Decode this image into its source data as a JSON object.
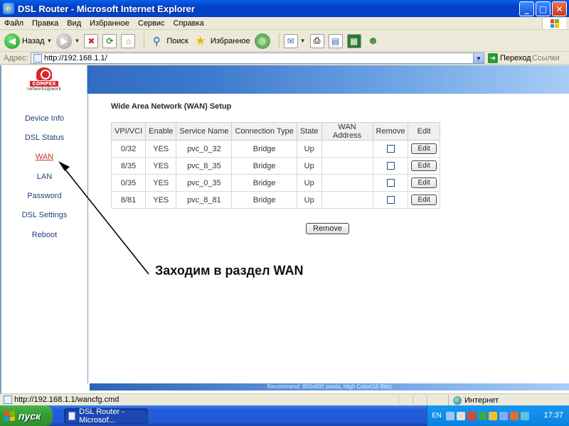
{
  "window": {
    "title": "DSL Router - Microsoft Internet Explorer",
    "controls": {
      "minimize": "_",
      "maximize": "□",
      "close": "✕"
    }
  },
  "menu": [
    "Файл",
    "Правка",
    "Вид",
    "Избранное",
    "Сервис",
    "Справка"
  ],
  "toolbar": {
    "back": "Назад",
    "search": "Поиск",
    "favorites": "Избранное"
  },
  "address": {
    "label": "Адрес:",
    "url": "http://192.168.1.1/",
    "go": "Переход",
    "links": "Ссылки"
  },
  "logo": {
    "name": "COMPEX",
    "sub": "networks@work"
  },
  "nav": {
    "items": [
      {
        "label": "Device Info"
      },
      {
        "label": "DSL Status"
      },
      {
        "label": "WAN"
      },
      {
        "label": "LAN"
      },
      {
        "label": "Password"
      },
      {
        "label": "DSL Settings"
      },
      {
        "label": "Reboot"
      }
    ],
    "active": "WAN"
  },
  "main": {
    "heading": "Wide Area Network (WAN) Setup",
    "columns": [
      "VPI/VCI",
      "Enable",
      "Service Name",
      "Connection Type",
      "State",
      "WAN Address",
      "Remove",
      "Edit"
    ],
    "rows": [
      {
        "vpivci": "0/32",
        "enable": "YES",
        "service": "pvc_0_32",
        "type": "Bridge",
        "state": "Up",
        "wan": "",
        "edit": "Edit"
      },
      {
        "vpivci": "8/35",
        "enable": "YES",
        "service": "pvc_8_35",
        "type": "Bridge",
        "state": "Up",
        "wan": "",
        "edit": "Edit"
      },
      {
        "vpivci": "0/35",
        "enable": "YES",
        "service": "pvc_0_35",
        "type": "Bridge",
        "state": "Up",
        "wan": "",
        "edit": "Edit"
      },
      {
        "vpivci": "8/81",
        "enable": "YES",
        "service": "pvc_8_81",
        "type": "Bridge",
        "state": "Up",
        "wan": "",
        "edit": "Edit"
      }
    ],
    "remove_button": "Remove"
  },
  "annotation": "Заходим в раздел WAN",
  "footer_note": "Recommend: 800x600 pixels, High Color(16 Bits)",
  "status": {
    "url": "http://192.168.1.1/wancfg.cmd",
    "zone": "Интернет"
  },
  "taskbar": {
    "start": "пуск",
    "task": "DSL Router - Microsof...",
    "lang": "EN",
    "time": "17:37"
  },
  "colors": {
    "titlebar": "#0240c7",
    "nav_active": "#c6322c",
    "nav_link": "#1f3f7a",
    "header_band": "#3c78cc"
  }
}
